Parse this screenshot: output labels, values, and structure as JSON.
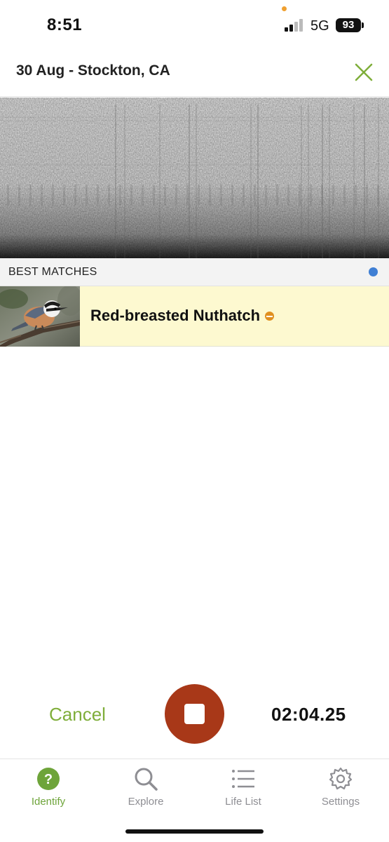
{
  "status_bar": {
    "time": "8:51",
    "network": "5G",
    "battery": "93"
  },
  "header": {
    "title": "30 Aug - Stockton, CA",
    "close_icon": "close-icon"
  },
  "matches": {
    "section_label": "BEST MATCHES",
    "items": [
      {
        "species": "Red-breasted Nuthatch",
        "rarity_icon": "rarity-icon"
      }
    ]
  },
  "recording": {
    "cancel_label": "Cancel",
    "timer": "02:04.25",
    "stop_icon": "stop-icon"
  },
  "tabs": [
    {
      "label": "Identify",
      "icon": "question-icon",
      "active": true
    },
    {
      "label": "Explore",
      "icon": "search-icon",
      "active": false
    },
    {
      "label": "Life List",
      "icon": "list-icon",
      "active": false
    },
    {
      "label": "Settings",
      "icon": "gear-icon",
      "active": false
    }
  ],
  "colors": {
    "accent_green": "#7fae3a",
    "record_red": "#a83818",
    "match_highlight": "#fdf9d0",
    "activity_blue": "#3f7fd4"
  }
}
